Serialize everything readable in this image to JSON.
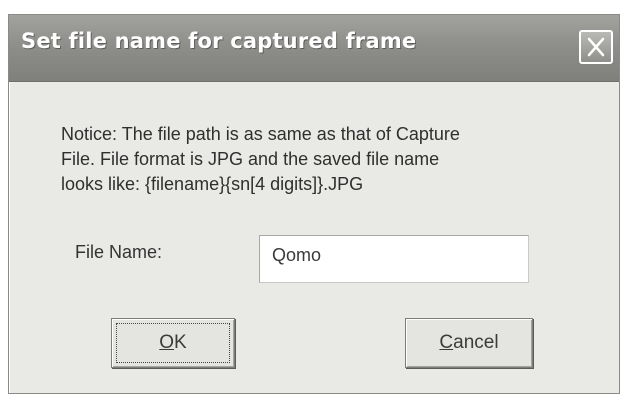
{
  "dialog": {
    "title": "Set file name for captured frame",
    "close_icon": "close-icon"
  },
  "notice": {
    "lines": [
      "Notice: The file path is as same as that of Capture",
      "File. File format is JPG and the saved file name",
      "looks like: {filename}{sn[4 digits]}.JPG"
    ]
  },
  "file_name": {
    "label": "File Name:",
    "value": "Qomo"
  },
  "buttons": {
    "ok": {
      "mnemonic": "O",
      "rest": "K"
    },
    "cancel": {
      "mnemonic": "C",
      "rest": "ancel"
    }
  }
}
